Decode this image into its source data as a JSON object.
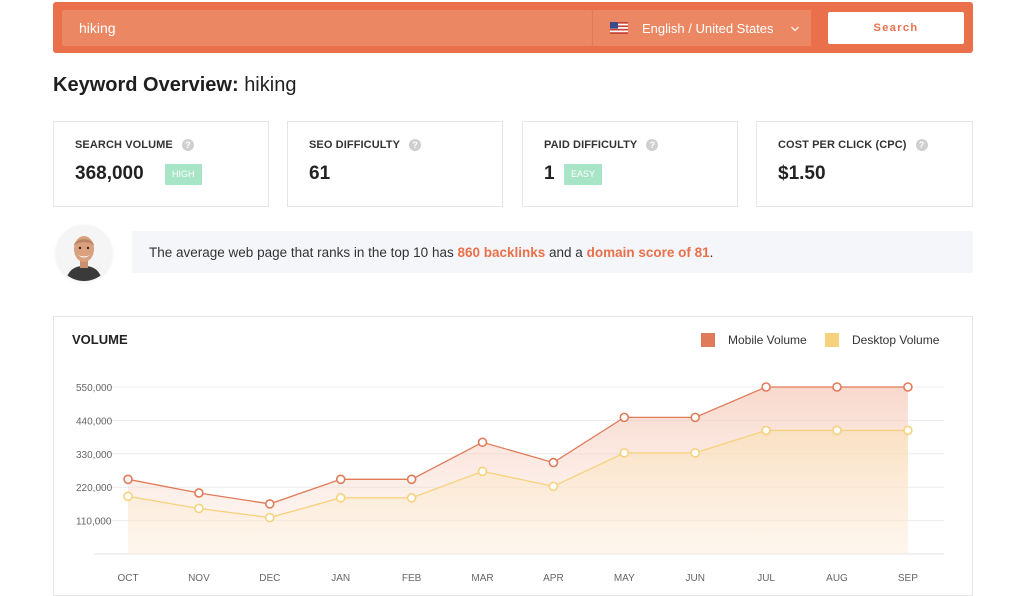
{
  "search": {
    "value": "hiking",
    "language": "English / United States",
    "button_label": "Search",
    "accent": "#e9704a"
  },
  "overview": {
    "title_prefix": "Keyword Overview:",
    "keyword": "hiking"
  },
  "metrics": [
    {
      "label": "SEARCH VOLUME",
      "value": "368,000",
      "badge": "HIGH"
    },
    {
      "label": "SEO DIFFICULTY",
      "value": "61",
      "badge": ""
    },
    {
      "label": "PAID DIFFICULTY",
      "value": "1",
      "badge": "EASY"
    },
    {
      "label": "COST PER CLICK (CPC)",
      "value": "$1.50",
      "badge": ""
    }
  ],
  "help_icon": "?",
  "info": {
    "text_1": "The average web page that ranks in the top 10 has ",
    "highlight_1": "860 backlinks",
    "text_2": " and a ",
    "highlight_2": "domain score of 81",
    "text_3": "."
  },
  "chart_data": {
    "type": "area",
    "title": "VOLUME",
    "categories": [
      "OCT",
      "NOV",
      "DEC",
      "JAN",
      "FEB",
      "MAR",
      "APR",
      "MAY",
      "JUN",
      "JUL",
      "AUG",
      "SEP"
    ],
    "y_ticks": [
      "110,000",
      "220,000",
      "330,000",
      "440,000",
      "550,000"
    ],
    "ylim": [
      0,
      550000
    ],
    "grid": true,
    "legend_position": "top-right",
    "series": [
      {
        "name": "Mobile Volume",
        "color": "#e07b59",
        "values": [
          246000,
          201000,
          165000,
          246000,
          246000,
          368000,
          301000,
          450000,
          450000,
          550000,
          550000,
          550000
        ]
      },
      {
        "name": "Desktop Volume",
        "color": "#f7d27e",
        "values": [
          190000,
          150000,
          120000,
          185000,
          185000,
          272000,
          223000,
          333000,
          333000,
          407000,
          407000,
          407000
        ]
      }
    ]
  }
}
